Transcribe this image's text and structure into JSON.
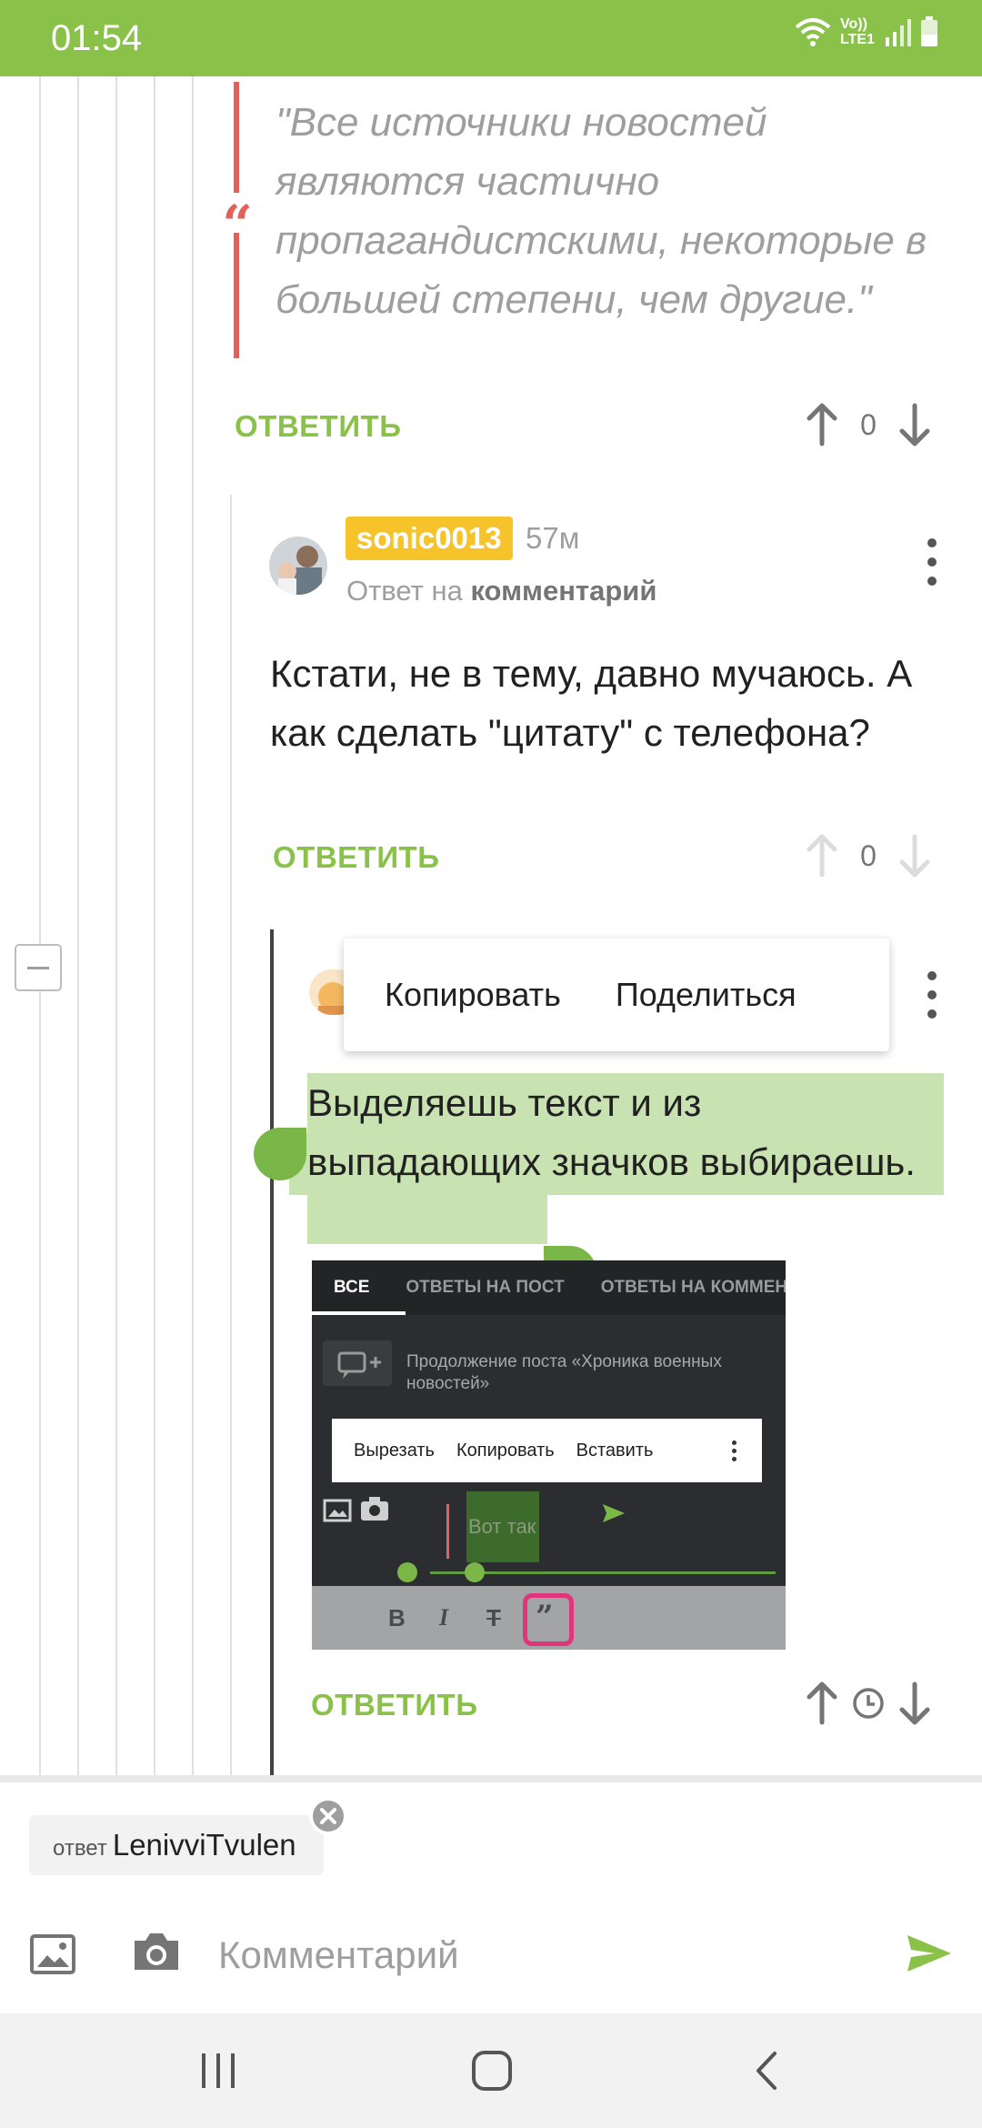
{
  "status_bar": {
    "time": "01:54",
    "network": "Vo)) LTE1"
  },
  "parent_comment": {
    "quote": "\"Все источники новостей являются частично пропагандистскими, некоторые в большей степени, чем другие.\"",
    "reply_label": "ОТВЕТИТЬ",
    "score": "0"
  },
  "comment": {
    "author": "sonic0013",
    "time_ago": "57м",
    "reply_to_prefix": "Ответ на",
    "reply_to_target": "комментарий",
    "text": "Кстати, не в тему, давно мучаюсь. А как сделать \"цитату\" с телефона?",
    "reply_label": "ОТВЕТИТЬ",
    "score": "0"
  },
  "context_menu": {
    "copy": "Копировать",
    "share": "Поделиться"
  },
  "reply_comment": {
    "selected_text": "Выделяешь текст и из выпадающих значков выбираешь.",
    "reply_label": "ОТВЕТИТЬ"
  },
  "embedded_screenshot": {
    "tabs": [
      "ВСЕ",
      "ОТВЕТЫ НА ПОСТ",
      "ОТВЕТЫ НА КОММЕНТАРИИ"
    ],
    "post_continuation": "Продолжение поста «Хроника военных новостей»",
    "menu": [
      "Вырезать",
      "Копировать",
      "Вставить"
    ],
    "sample_text": "Вот так"
  },
  "composer": {
    "reply_chip_prefix": "ответ",
    "reply_chip_user": "LenivviTvulen",
    "placeholder": "Комментарий"
  },
  "colors": {
    "accent": "#8ac249",
    "quote": "#e0625a",
    "nick_badge": "#f7c32a",
    "selection": "#c9e2b2"
  },
  "icons": [
    "wifi-icon",
    "signal-icon",
    "battery-icon",
    "arrow-up-icon",
    "arrow-down-icon",
    "more-icon",
    "clock-icon",
    "image-icon",
    "camera-icon",
    "send-icon",
    "close-icon",
    "recent-apps-icon",
    "home-icon",
    "back-icon"
  ]
}
